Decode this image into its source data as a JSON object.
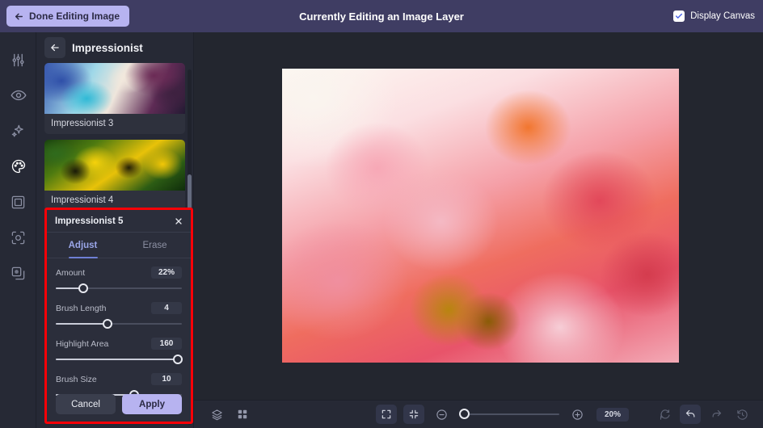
{
  "topbar": {
    "done_label": "Done Editing Image",
    "back_icon": "arrow-left-icon",
    "title": "Currently Editing an Image Layer",
    "display_canvas_label": "Display Canvas",
    "display_canvas_checked": true,
    "background": "#3f3d63",
    "accent": "#b7b3f0"
  },
  "rail": {
    "items": [
      {
        "icon": "adjustments-sliders-icon",
        "active": false
      },
      {
        "icon": "eye-icon",
        "active": false
      },
      {
        "icon": "sparkles-icon",
        "active": false
      },
      {
        "icon": "palette-icon",
        "active": true
      },
      {
        "icon": "frame-icon",
        "active": false
      },
      {
        "icon": "focus-crop-icon",
        "active": false
      },
      {
        "icon": "layers-duplicate-icon",
        "active": false
      }
    ]
  },
  "panel": {
    "back_icon": "arrow-left-icon",
    "title": "Impressionist",
    "thumbnails": [
      {
        "label": "Impressionist 3",
        "style": "thumb-impr3"
      },
      {
        "label": "Impressionist 4",
        "style": "thumb-impr4"
      }
    ]
  },
  "settings": {
    "title": "Impressionist 5",
    "close_icon": "close-icon",
    "highlight_color": "#fb0007",
    "tabs": [
      {
        "label": "Adjust",
        "active": true
      },
      {
        "label": "Erase",
        "active": false
      }
    ],
    "sliders": [
      {
        "name": "Amount",
        "value": "22%",
        "percent": 22
      },
      {
        "name": "Brush Length",
        "value": "4",
        "percent": 41
      },
      {
        "name": "Highlight Area",
        "value": "160",
        "percent": 97
      },
      {
        "name": "Brush Size",
        "value": "10",
        "percent": 62
      }
    ],
    "cancel_label": "Cancel",
    "apply_label": "Apply"
  },
  "bottombar": {
    "left_icons": [
      {
        "icon": "layers-icon",
        "boxed": false
      },
      {
        "icon": "grid-icon",
        "boxed": false
      }
    ],
    "center_icons": [
      {
        "icon": "expand-fullscreen-icon",
        "boxed": true
      },
      {
        "icon": "fit-to-screen-icon",
        "boxed": true
      }
    ],
    "zoom_out_icon": "minus-circle-icon",
    "zoom_in_icon": "plus-circle-icon",
    "zoom_value": "20%",
    "zoom_percent": 20,
    "right_icons": [
      {
        "icon": "reset-refresh-icon",
        "boxed": false,
        "dim": true
      },
      {
        "icon": "undo-icon",
        "boxed": true,
        "dim": false
      },
      {
        "icon": "redo-icon",
        "boxed": false,
        "dim": true
      },
      {
        "icon": "history-clock-icon",
        "boxed": false,
        "dim": true
      }
    ]
  },
  "canvas": {
    "description": "pink and orange peony flower close-up photograph"
  }
}
